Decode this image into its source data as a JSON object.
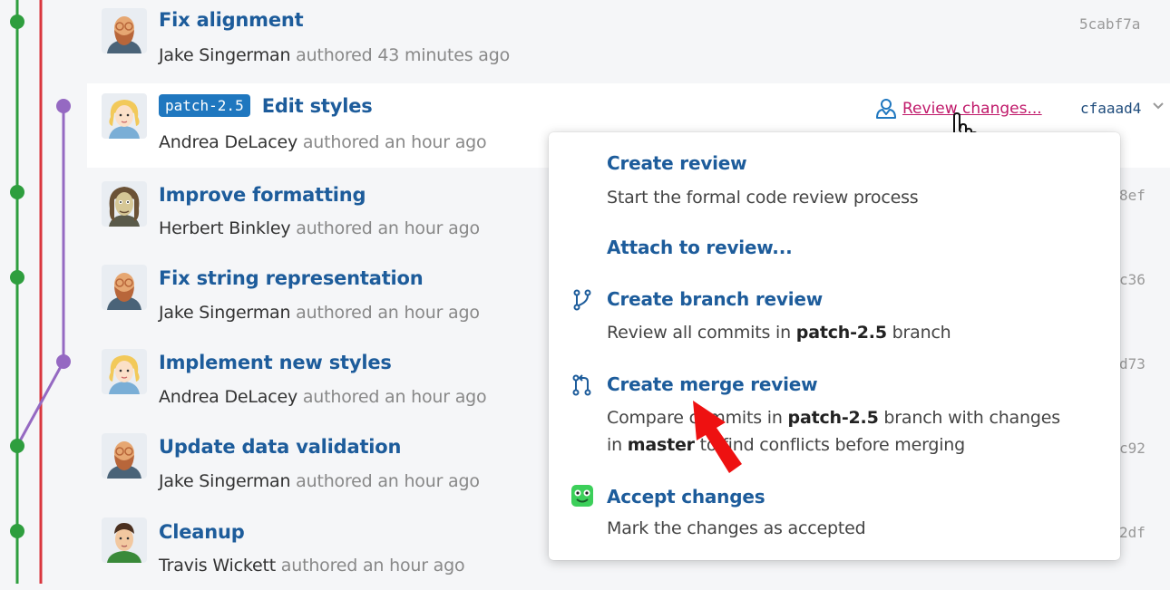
{
  "commits": [
    {
      "title": "Fix alignment",
      "author": "Jake Singerman",
      "time": "authored 43 minutes ago",
      "hash": "5cabf7a",
      "avatar": "bearded-man-glasses"
    },
    {
      "title": "Edit styles",
      "branch": "patch-2.5",
      "author": "Andrea DeLacey",
      "time": "authored an hour ago",
      "hash": "cfaaad4",
      "avatar": "blonde-woman"
    },
    {
      "title": "Improve formatting",
      "author": "Herbert Binkley",
      "time": "authored an hour ago",
      "hash": "8ef",
      "avatar": "long-haired-man"
    },
    {
      "title": "Fix string representation",
      "author": "Jake Singerman",
      "time": "authored an hour ago",
      "hash": "c36",
      "avatar": "bearded-man-glasses"
    },
    {
      "title": "Implement new styles",
      "author": "Andrea DeLacey",
      "time": "authored an hour ago",
      "hash": "d73",
      "avatar": "blonde-woman"
    },
    {
      "title": "Update data validation",
      "author": "Jake Singerman",
      "time": "authored an hour ago",
      "hash": "c92",
      "avatar": "bearded-man-glasses"
    },
    {
      "title": "Cleanup",
      "author": "Travis Wickett",
      "time": "authored an hour ago",
      "hash": "2df",
      "avatar": "man-green-shirt"
    }
  ],
  "review_link": {
    "label": "Review changes...",
    "icon": "review-person-icon"
  },
  "menu": {
    "create_review": {
      "title": "Create review",
      "desc": "Start the formal code review process"
    },
    "attach_review": {
      "title": "Attach to review..."
    },
    "branch_review": {
      "title": "Create branch review",
      "desc_pre": "Review all commits in ",
      "desc_branch": "patch-2.5",
      "desc_post": " branch",
      "icon": "branch-icon"
    },
    "merge_review": {
      "title": "Create merge review",
      "desc_pre": "Compare commits in ",
      "desc_branch": "patch-2.5",
      "desc_mid": " branch with changes in ",
      "desc_target": "master",
      "desc_post": " to find conflicts before merging",
      "icon": "merge-icon"
    },
    "accept": {
      "title": "Accept changes",
      "desc": "Mark the changes as accepted",
      "icon": "accept-face-icon"
    }
  },
  "colors": {
    "graph_green": "#2e9e3e",
    "graph_red": "#d9363e",
    "graph_purple": "#9569c2",
    "link": "#1d5c9b",
    "badge": "#1f77bf",
    "review_link": "#c0196a",
    "annotation_arrow": "#ee1111"
  }
}
